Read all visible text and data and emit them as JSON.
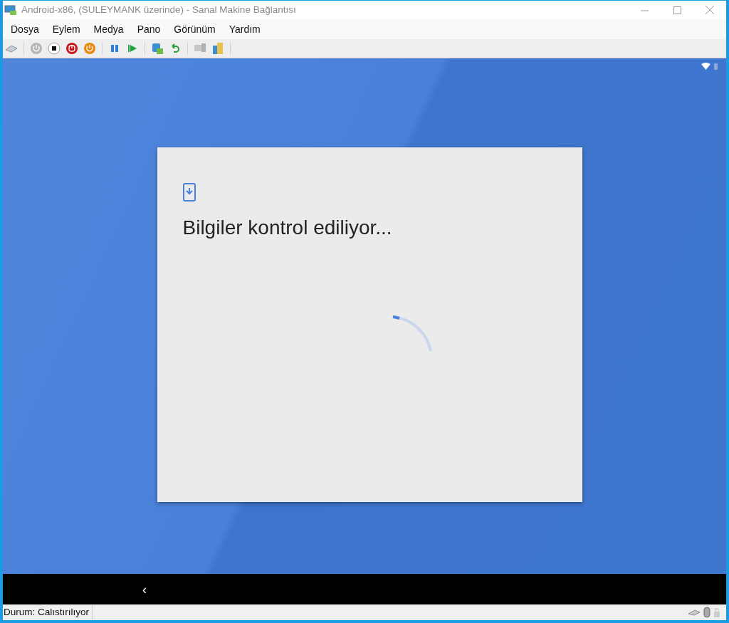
{
  "window": {
    "title": "Android-x86, (SULEYMANK üzerinde) - Sanal Makine Bağlantısı"
  },
  "menu": [
    "Dosya",
    "Eylem",
    "Medya",
    "Pano",
    "Görünüm",
    "Yardım"
  ],
  "dialog": {
    "title": "Bilgiler kontrol ediliyor..."
  },
  "nav_bar": {
    "back": "‹"
  },
  "status_bar": {
    "text": "Durum: Calıstırılıyor"
  }
}
